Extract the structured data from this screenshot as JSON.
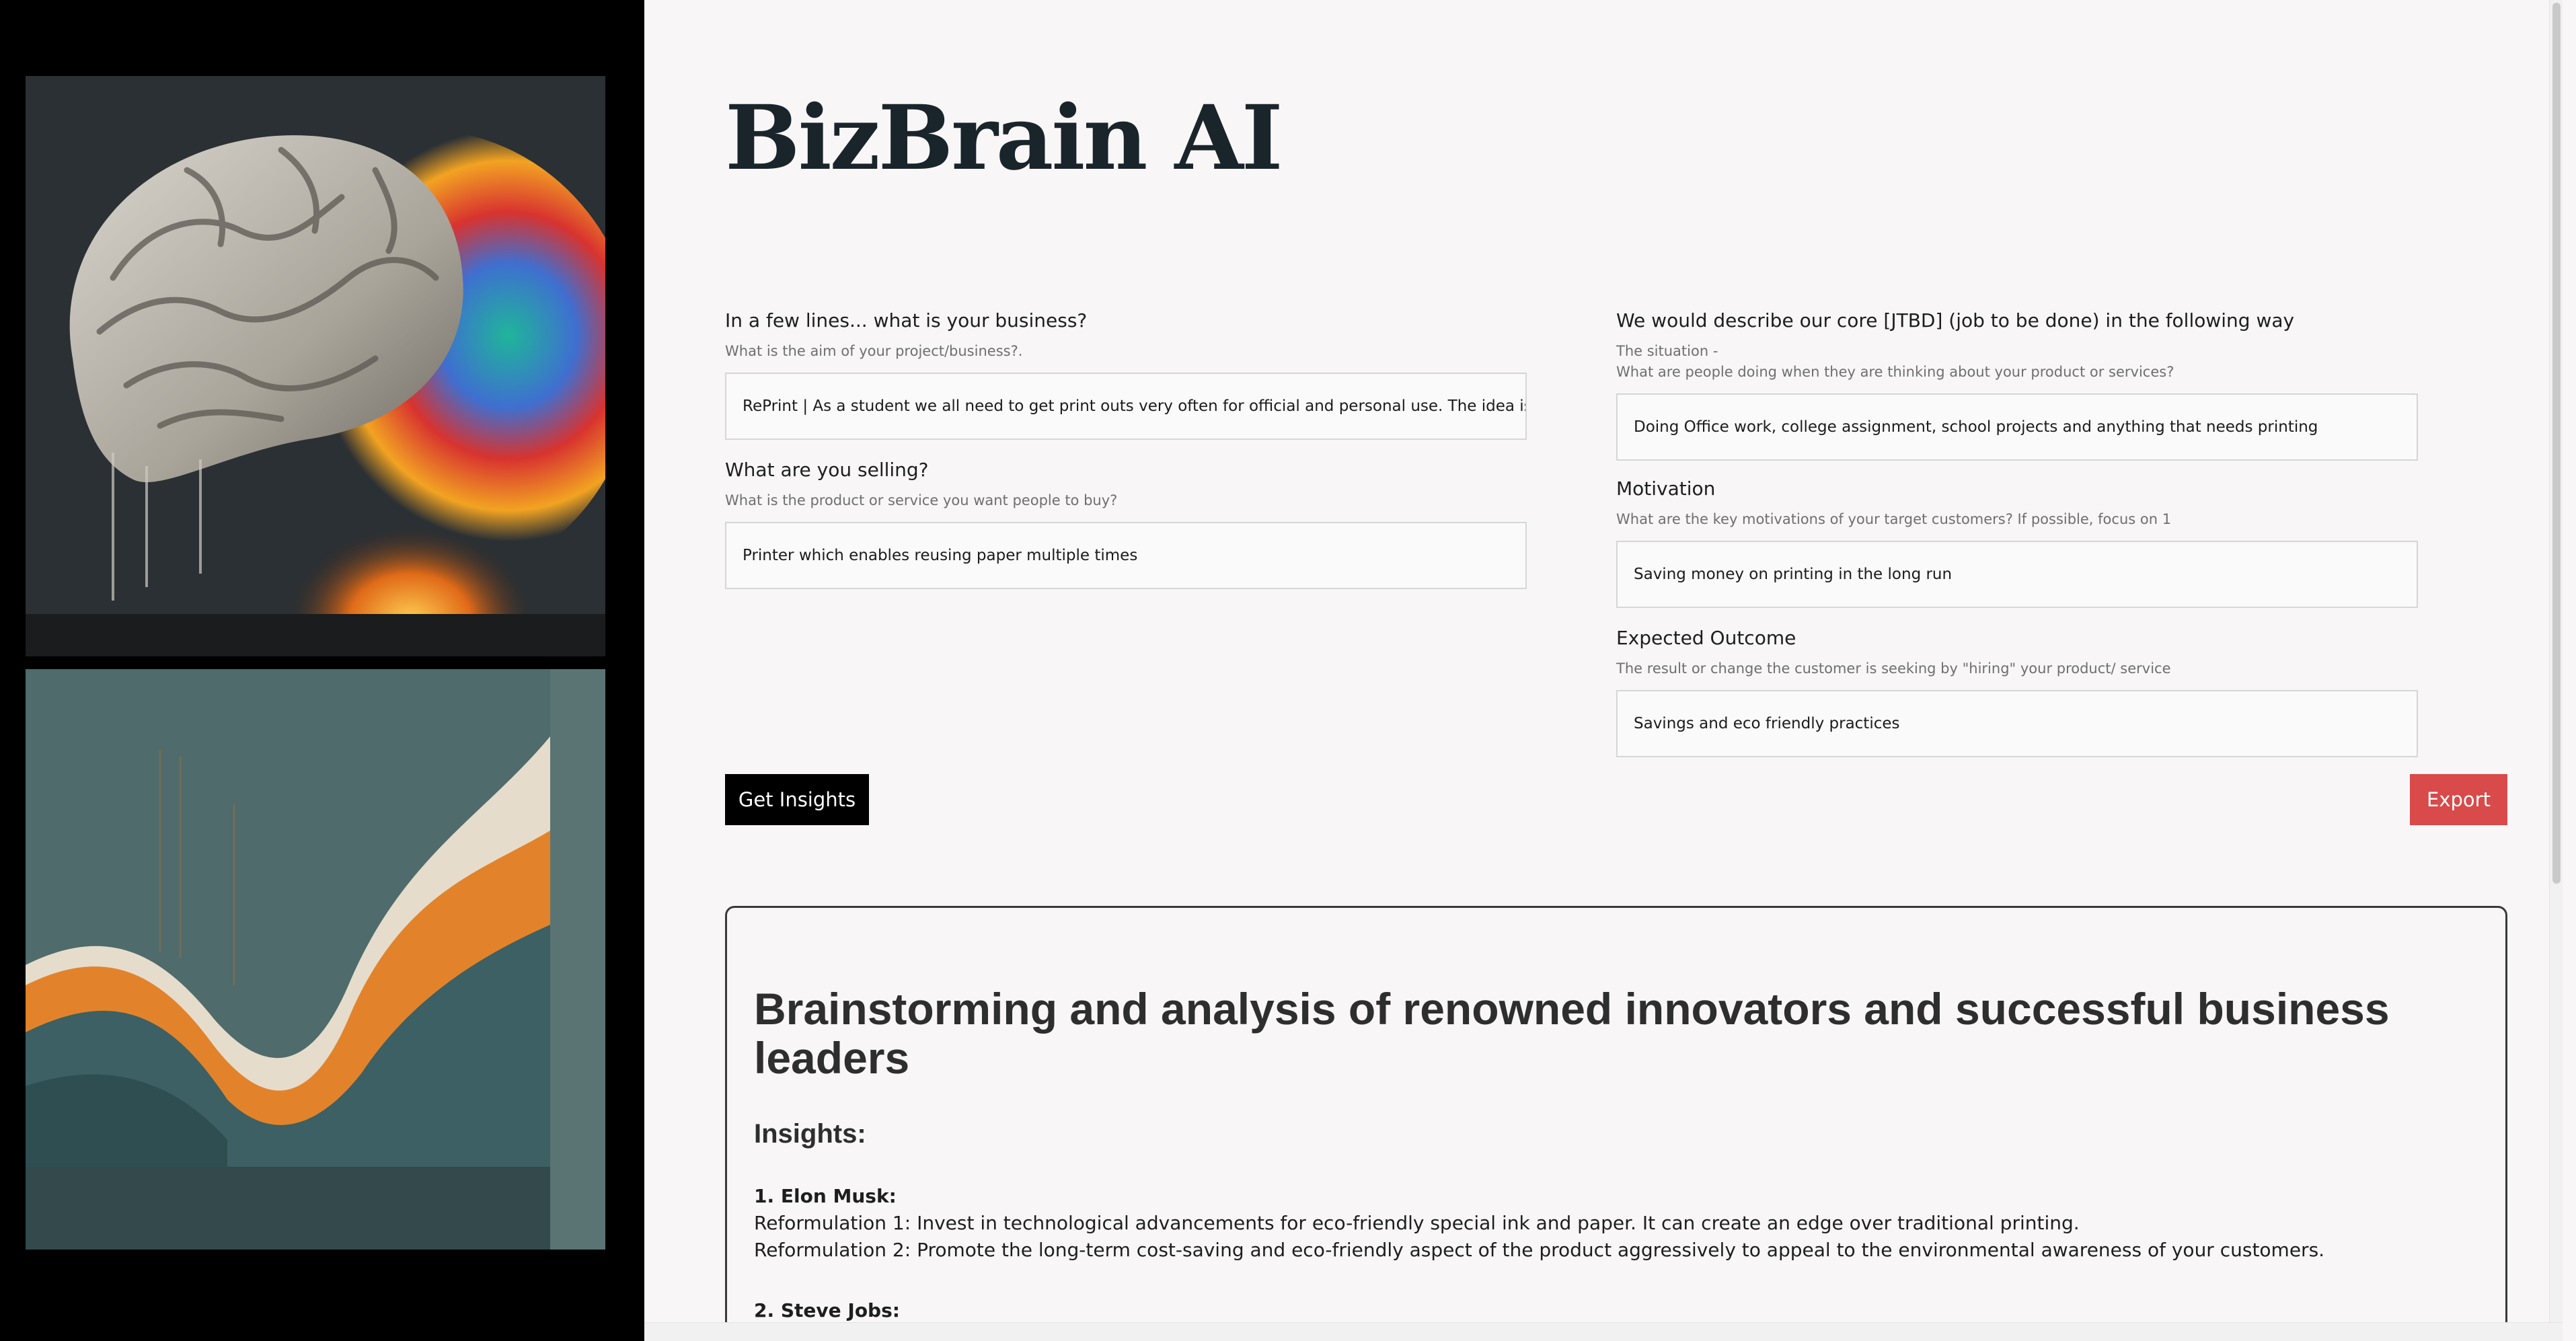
{
  "app": {
    "title": "BizBrain AI"
  },
  "images": {
    "top": "brain-artwork",
    "bottom": "abstract-wave-artwork"
  },
  "form": {
    "business": {
      "label": "In a few lines... what is your business?",
      "hint": "What is the aim of your project/business?.",
      "value": "RePrint | As a student we all need to get print outs very often for official and personal use. The idea is to"
    },
    "selling": {
      "label": "What are you selling?",
      "hint": "What is the product or service you want people to buy?",
      "value": "Printer which enables reusing paper multiple times"
    },
    "jtbd": {
      "label": "We would describe our core [JTBD] (job to be done) in the following way",
      "hint_line1": "The situation -",
      "hint_line2": "What are people doing when they are thinking about your product or services?",
      "value": "Doing Office work, college assignment, school projects and anything that needs printing"
    },
    "motivation": {
      "label": "Motivation",
      "hint": "What are the key motivations of your target customers? If possible, focus on 1",
      "value": "Saving money on printing in the long run"
    },
    "outcome": {
      "label": "Expected Outcome",
      "hint": "The result or change the customer is seeking by \"hiring\" your product/ service",
      "value": "Savings and eco friendly practices"
    }
  },
  "buttons": {
    "insights": "Get Insights",
    "export": "Export"
  },
  "results": {
    "heading": "Brainstorming and analysis of renowned innovators and successful business leaders",
    "subheading": "Insights:",
    "items": [
      {
        "name": "1. Elon Musk:",
        "lines": [
          "Reformulation 1: Invest in technological advancements for eco-friendly special ink and paper. It can create an edge over traditional printing.",
          "Reformulation 2: Promote the long-term cost-saving and eco-friendly aspect of the product aggressively to appeal to the environmental awareness of your customers."
        ]
      },
      {
        "name": "2. Steve Jobs:",
        "lines": []
      }
    ]
  },
  "colors": {
    "brand": "#1a242b",
    "export_button": "#d94a4a",
    "insights_button": "#000000",
    "left_panel": "#000000"
  }
}
